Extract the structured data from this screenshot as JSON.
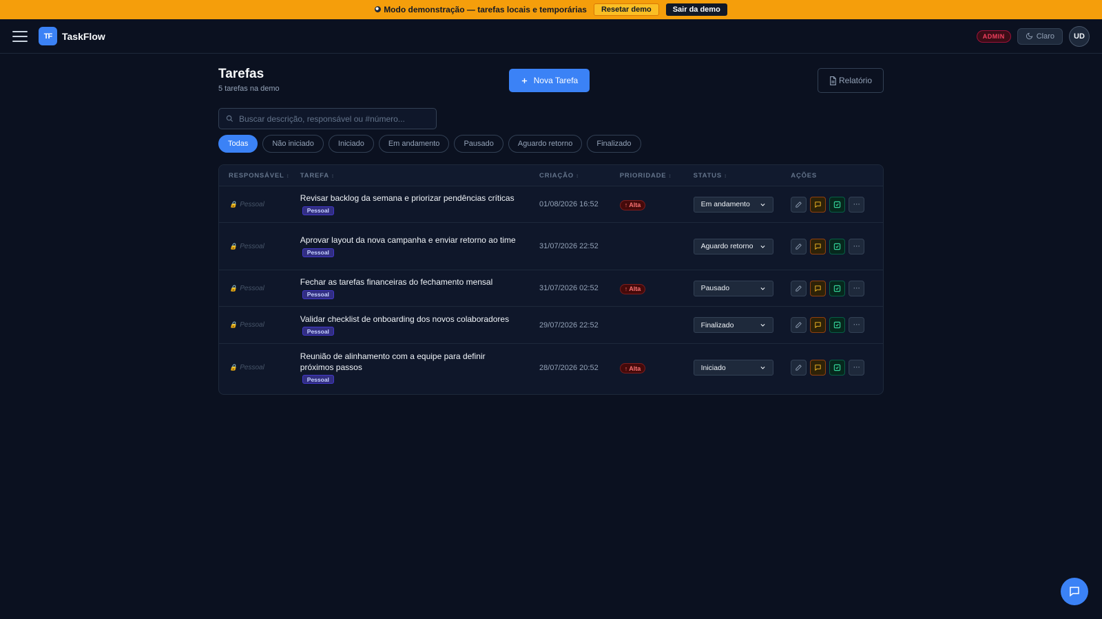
{
  "banner": {
    "text": "Modo demonstração — tarefas locais e temporárias",
    "reset_label": "Resetar demo",
    "exit_label": "Sair da demo"
  },
  "header": {
    "logo_text": "TF",
    "brand": "TaskFlow",
    "role_badge": "ADMIN",
    "theme_label": "Claro",
    "avatar_initials": "UD"
  },
  "page": {
    "title": "Tarefas",
    "subtitle": "5 tarefas na demo",
    "new_task_label": "Nova Tarefa",
    "report_label": "Relatório",
    "search_placeholder": "Buscar descrição, responsável ou #número..."
  },
  "filters": [
    {
      "label": "Todas",
      "active": true
    },
    {
      "label": "Não iniciado",
      "active": false
    },
    {
      "label": "Iniciado",
      "active": false
    },
    {
      "label": "Em andamento",
      "active": false
    },
    {
      "label": "Pausado",
      "active": false
    },
    {
      "label": "Aguardo retorno",
      "active": false
    },
    {
      "label": "Finalizado",
      "active": false
    }
  ],
  "table": {
    "headers": {
      "owner": "RESPONSÁVEL",
      "task": "TAREFA",
      "created": "CRIAÇÃO",
      "priority": "PRIORIDADE",
      "status": "STATUS",
      "actions": "AÇÕES"
    },
    "rows": [
      {
        "owner": "Pessoal",
        "task": "Revisar backlog da semana e priorizar pendências críticas",
        "tag": "Pessoal",
        "created": "01/08/2026 16:52",
        "priority": "Alta",
        "status": "Em andamento",
        "height": 53
      },
      {
        "owner": "Pessoal",
        "task": "Aprovar layout da nova campanha e enviar retorno ao time",
        "tag": "Pessoal",
        "created": "31/07/2026 22:52",
        "priority": "",
        "status": "Aguardo retorno",
        "height": 69
      },
      {
        "owner": "Pessoal",
        "task": "Fechar as tarefas financeiras do fechamento mensal",
        "tag": "Pessoal",
        "created": "31/07/2026 02:52",
        "priority": "Alta",
        "status": "Pausado",
        "height": 53
      },
      {
        "owner": "Pessoal",
        "task": "Validar checklist de onboarding dos novos colaboradores",
        "tag": "Pessoal",
        "created": "29/07/2026 22:52",
        "priority": "",
        "status": "Finalizado",
        "height": 54
      },
      {
        "owner": "Pessoal",
        "task": "Reunião de alinhamento com a equipe para definir próximos passos",
        "tag": "Pessoal",
        "created": "28/07/2026 20:52",
        "priority": "Alta",
        "status": "Iniciado",
        "height": 69
      }
    ]
  }
}
